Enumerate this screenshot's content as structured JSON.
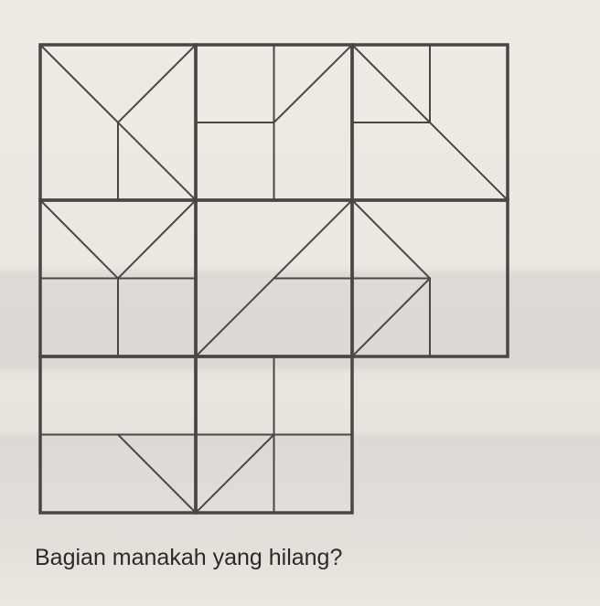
{
  "question": "Bagian manakah yang hilang?",
  "puzzle": {
    "rows": 3,
    "cols": 3,
    "missing_cell": "row 3, column 3",
    "line_color": "#4a4646"
  }
}
